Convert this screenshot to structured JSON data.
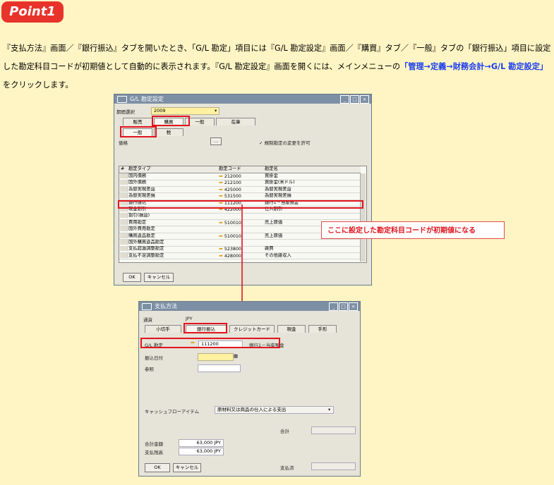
{
  "badge": "Point1",
  "intro": {
    "part1": "『支払方法』画面／『銀行振込』タブを開いたとき、「G/L 勘定」項目には『G/L 勘定設定』画面／『購買』タブ／『一般』タブの「銀行振込」項目に設定した勘定科目コードが初期値として自動的に表示されます。『G/L 勘定設定』画面を開くには、メインメニューの",
    "link": "「管理→定義→財務会計→G/L 勘定設定」",
    "part2": "をクリックします。"
  },
  "gl_window": {
    "title": "G/L 勘定設定",
    "period_label": "期間選択",
    "period_value": "2009",
    "main_tabs": [
      "販売",
      "購買",
      "一般",
      "在庫"
    ],
    "sub_tabs": [
      "一般",
      "税"
    ],
    "filter_label": "価格",
    "filter_btn": "...",
    "checkbox_label": "✓ 規制勘定の変更を許可",
    "columns": [
      "#",
      "勘定タイプ",
      "勘定コード",
      "勘定名"
    ],
    "rows": [
      {
        "type": "国内債務",
        "code": "212000",
        "name": "買掛金",
        "arrow": true
      },
      {
        "type": "国外債務",
        "code": "212100",
        "name": "買掛金(米ドル)",
        "arrow": true
      },
      {
        "type": "為替実現差益",
        "code": "425000",
        "name": "為替実現差益",
        "arrow": true
      },
      {
        "type": "為替実現差損",
        "code": "531500",
        "name": "為替実現差損",
        "arrow": true
      },
      {
        "type": "銀行振込",
        "code": "111200",
        "name": "銀行1－当座預金",
        "arrow": true
      },
      {
        "type": "現金割引",
        "code": "422000",
        "name": "仕入割引",
        "arrow": true
      },
      {
        "type": "割引(損益)",
        "code": "",
        "name": "",
        "arrow": false
      },
      {
        "type": "費用勘定",
        "code": "510010",
        "name": "売上原価",
        "arrow": true
      },
      {
        "type": "国外費用勘定",
        "code": "",
        "name": "",
        "arrow": false
      },
      {
        "type": "購買返品勘定",
        "code": "510010",
        "name": "売上原価",
        "arrow": true
      },
      {
        "type": "国外購買返品勘定",
        "code": "",
        "name": "",
        "arrow": false
      },
      {
        "type": "支払超過調整勘定",
        "code": "523800",
        "name": "雑費",
        "arrow": true
      },
      {
        "type": "支払不足調整勘定",
        "code": "428000",
        "name": "その他雑収入",
        "arrow": true
      }
    ],
    "ok_btn": "OK",
    "cancel_btn": "キャンセル"
  },
  "callout": "ここに設定した勘定科目コードが初期値になる",
  "pay_window": {
    "title": "支払方法",
    "currency_label": "通貨",
    "currency_value": "JPY",
    "tabs": [
      "小切手",
      "銀行振込",
      "クレジットカード",
      "現金",
      "手形"
    ],
    "gl_label": "G/L 勘定",
    "gl_code": "111200",
    "gl_name": "銀行1－当座預金",
    "transfer_date_label": "振込日付",
    "reference_label": "参照",
    "cashflow_label": "キャッシュフローアイテム",
    "cashflow_value": "原材料又は商品の仕入による支出",
    "subtotal_label": "合計",
    "total_label": "合計金額",
    "total_value": "63,000 JPY",
    "due_label": "支払残高",
    "due_value": "63,000 JPY",
    "paid_label": "支払済",
    "ok_btn": "OK",
    "cancel_btn": "キャンセル"
  },
  "colors": {
    "accent_red": "#e0141e",
    "link_blue": "#1a3df0",
    "background": "#fff5c4"
  }
}
